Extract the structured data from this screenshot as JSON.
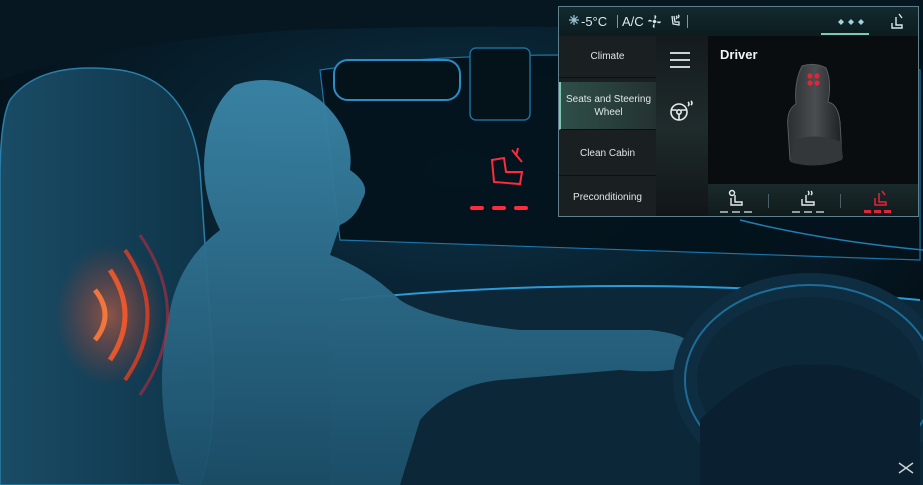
{
  "topbar": {
    "temperature": "-5°C",
    "ac_label": "A/C"
  },
  "sidebar": {
    "items": [
      {
        "label": "Climate",
        "active": false
      },
      {
        "label": "Seats and Steering Wheel",
        "active": true
      },
      {
        "label": "Clean Cabin",
        "active": false
      },
      {
        "label": "Preconditioning",
        "active": false
      }
    ]
  },
  "main": {
    "title": "Driver"
  },
  "colors": {
    "accent": "#7ec9b4",
    "heat": "#e0253a",
    "glow": "#1e7fb8"
  },
  "icons": {
    "temperature": "snowflake-icon",
    "fan": "fan-icon",
    "seat_airflow": "seat-airflow-icon",
    "seat_profile": "seat-profile-icon",
    "menu": "menu-icon",
    "steering_heat": "heated-steering-wheel-icon",
    "seat_ventilation": "seat-ventilation-icon",
    "seat_heating": "seat-heating-icon",
    "seat_massage": "seat-massage-icon",
    "brand_logo": "ds-logo-icon"
  }
}
